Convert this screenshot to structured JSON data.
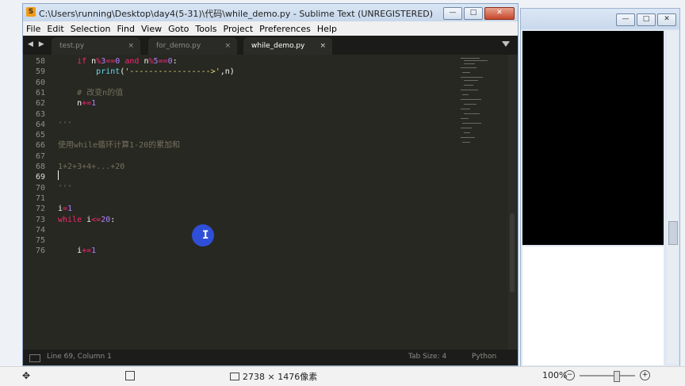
{
  "window": {
    "title": "C:\\Users\\running\\Desktop\\day4(5-31)\\代码\\while_demo.py - Sublime Text (UNREGISTERED)",
    "minimize": "—",
    "maximize": "□",
    "close": "✕"
  },
  "menu": [
    "File",
    "Edit",
    "Selection",
    "Find",
    "View",
    "Goto",
    "Tools",
    "Project",
    "Preferences",
    "Help"
  ],
  "tabs": [
    {
      "label": "test.py",
      "close": "×"
    },
    {
      "label": "for_demo.py",
      "close": "×"
    },
    {
      "label": "while_demo.py",
      "close": "×"
    }
  ],
  "nav_arrows": "◀ ▶",
  "editor": {
    "lines": [
      {
        "num": "58",
        "indent": "    ",
        "tokens": [
          {
            "t": "if",
            "c": "kw"
          },
          {
            "t": " n"
          },
          {
            "t": "%",
            "c": "kw"
          },
          {
            "t": "3",
            "c": "num"
          },
          {
            "t": "==",
            "c": "kw"
          },
          {
            "t": "0",
            "c": "num"
          },
          {
            "t": " "
          },
          {
            "t": "and",
            "c": "kw"
          },
          {
            "t": " n"
          },
          {
            "t": "%",
            "c": "kw"
          },
          {
            "t": "5",
            "c": "num"
          },
          {
            "t": "==",
            "c": "kw"
          },
          {
            "t": "0",
            "c": "num"
          },
          {
            "t": ":"
          }
        ]
      },
      {
        "num": "59",
        "indent": "        ",
        "tokens": [
          {
            "t": "print",
            "c": "fn"
          },
          {
            "t": "("
          },
          {
            "t": "'----------------->'",
            "c": "str"
          },
          {
            "t": ",n)"
          }
        ]
      },
      {
        "num": "60",
        "indent": "",
        "tokens": []
      },
      {
        "num": "61",
        "indent": "    ",
        "tokens": [
          {
            "t": "# 改变n的值",
            "c": "cm"
          }
        ]
      },
      {
        "num": "62",
        "indent": "    ",
        "tokens": [
          {
            "t": "n"
          },
          {
            "t": "+=",
            "c": "kw"
          },
          {
            "t": "1",
            "c": "num"
          }
        ]
      },
      {
        "num": "63",
        "indent": "",
        "tokens": []
      },
      {
        "num": "64",
        "indent": "",
        "tokens": [
          {
            "t": "'''",
            "c": "cm"
          }
        ]
      },
      {
        "num": "65",
        "indent": "",
        "tokens": []
      },
      {
        "num": "66",
        "indent": "",
        "tokens": [
          {
            "t": "使用while循环计算1-20的累加和",
            "c": "cm"
          }
        ]
      },
      {
        "num": "67",
        "indent": "",
        "tokens": []
      },
      {
        "num": "68",
        "indent": "",
        "tokens": [
          {
            "t": "1+2+3+4+...+20",
            "c": "cm"
          }
        ]
      },
      {
        "num": "69",
        "indent": "",
        "tokens": []
      },
      {
        "num": "70",
        "indent": "",
        "tokens": [
          {
            "t": "'''",
            "c": "cm"
          }
        ]
      },
      {
        "num": "71",
        "indent": "",
        "tokens": []
      },
      {
        "num": "72",
        "indent": "",
        "tokens": [
          {
            "t": "i"
          },
          {
            "t": "=",
            "c": "kw"
          },
          {
            "t": "1",
            "c": "num"
          }
        ]
      },
      {
        "num": "73",
        "indent": "",
        "tokens": [
          {
            "t": "while",
            "c": "kw"
          },
          {
            "t": " i"
          },
          {
            "t": "<=",
            "c": "kw"
          },
          {
            "t": "20",
            "c": "num"
          },
          {
            "t": ":"
          }
        ]
      },
      {
        "num": "74",
        "indent": "",
        "tokens": []
      },
      {
        "num": "75",
        "indent": "",
        "tokens": []
      },
      {
        "num": "76",
        "indent": "    ",
        "tokens": [
          {
            "t": "i"
          },
          {
            "t": "+=",
            "c": "kw"
          },
          {
            "t": "1",
            "c": "num"
          }
        ]
      }
    ],
    "current_line": "69"
  },
  "status": {
    "position": "Line 69, Column 1",
    "tab_size": "Tab Size: 4",
    "syntax": "Python"
  },
  "viewer": {
    "dimensions": "2738 × 1476像素",
    "zoom": "100%",
    "zoom_out": "−",
    "zoom_in": "+",
    "zoom_level": 0.66
  },
  "colors": {
    "editor_bg": "#272822",
    "keyword": "#f92672",
    "number": "#ae81ff",
    "string": "#e6db74",
    "function": "#66d9ef",
    "comment": "#75715e"
  }
}
